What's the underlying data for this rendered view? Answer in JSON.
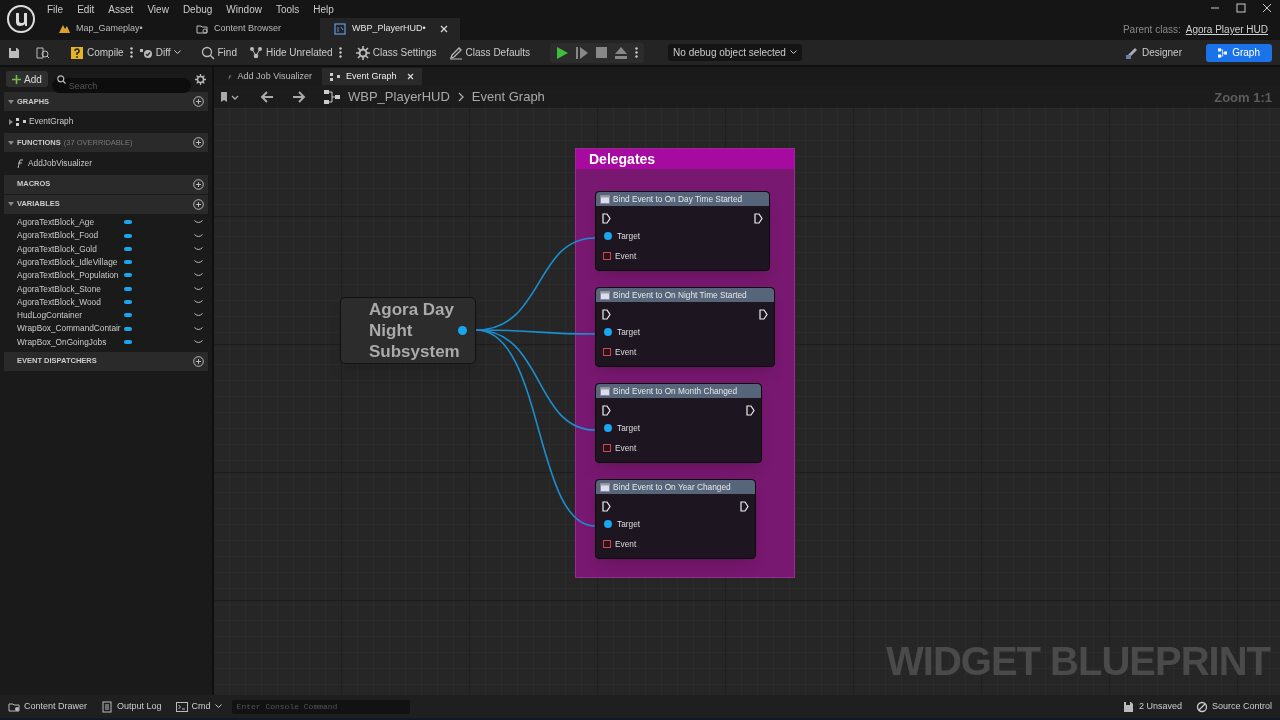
{
  "menu": [
    "File",
    "Edit",
    "Asset",
    "View",
    "Debug",
    "Window",
    "Tools",
    "Help"
  ],
  "document_tabs": [
    {
      "label": "Map_Gameplay•",
      "kind": "level",
      "selected": false,
      "closable": false
    },
    {
      "label": "Content Browser",
      "kind": "browser",
      "selected": false,
      "closable": false
    },
    {
      "label": "WBP_PlayerHUD•",
      "kind": "widget",
      "selected": true,
      "closable": true
    }
  ],
  "parent_class": {
    "label": "Parent class:",
    "value": "Agora Player HUD"
  },
  "toolbar": [
    {
      "label": "Compile",
      "kind": "compile",
      "menu": true
    },
    {
      "label": "Diff",
      "kind": "diff",
      "menu": false
    },
    {
      "label": "Find",
      "kind": "find",
      "menu": false
    },
    {
      "label": "Hide Unrelated",
      "kind": "hide",
      "menu": true
    },
    {
      "label": "Class Settings",
      "kind": "settings",
      "menu": false
    },
    {
      "label": "Class Defaults",
      "kind": "defaults",
      "menu": false
    }
  ],
  "debug_dropdown": "No debug object selected",
  "mode_buttons": [
    {
      "label": "Designer",
      "kind": "designer",
      "selected": false
    },
    {
      "label": "Graph",
      "kind": "graph",
      "selected": true
    }
  ],
  "my_blueprint": {
    "add_button": "Add",
    "search_placeholder": "Search",
    "sections": [
      {
        "title": "GRAPHS",
        "expanded": true,
        "items": [
          {
            "label": "EventGraph",
            "kind": "graph"
          }
        ]
      },
      {
        "title": "FUNCTIONS",
        "note": "(37 OVERRIDABLE)",
        "expanded": true,
        "items": [
          {
            "label": "AddJobVisualizer",
            "kind": "function"
          }
        ]
      },
      {
        "title": "MACROS",
        "expanded": false
      },
      {
        "title": "VARIABLES",
        "expanded": true,
        "items": [
          {
            "label": "AgoraTextBlock_Age",
            "kind": "variable"
          },
          {
            "label": "AgoraTextBlock_Food",
            "kind": "variable"
          },
          {
            "label": "AgoraTextBlock_Gold",
            "kind": "variable"
          },
          {
            "label": "AgoraTextBlock_IdleVillage",
            "kind": "variable"
          },
          {
            "label": "AgoraTextBlock_Population",
            "kind": "variable"
          },
          {
            "label": "AgoraTextBlock_Stone",
            "kind": "variable"
          },
          {
            "label": "AgoraTextBlock_Wood",
            "kind": "variable"
          },
          {
            "label": "HudLogContainer",
            "kind": "variable"
          },
          {
            "label": "WrapBox_CommandContair",
            "kind": "variable"
          },
          {
            "label": "WrapBox_OnGoingJobs",
            "kind": "variable"
          }
        ]
      },
      {
        "title": "EVENT DISPATCHERS",
        "expanded": false
      }
    ]
  },
  "graph_tabs": [
    {
      "label": "Add Job Visualizer",
      "kind": "function",
      "selected": false
    },
    {
      "label": "Event Graph",
      "kind": "graph",
      "selected": true
    }
  ],
  "breadcrumb": [
    "WBP_PlayerHUD",
    "Event Graph"
  ],
  "zoom_label": "Zoom 1:1",
  "graph": {
    "comment": "Delegates",
    "variable_node": "Agora Day Night Subsystem",
    "bind_nodes": [
      {
        "title": "Bind Event to On Day Time Started",
        "target": "Target",
        "event": "Event"
      },
      {
        "title": "Bind Event to On Night Time Started",
        "target": "Target",
        "event": "Event"
      },
      {
        "title": "Bind Event to On Month Changed",
        "target": "Target",
        "event": "Event"
      },
      {
        "title": "Bind Event to On Year Changed",
        "target": "Target",
        "event": "Event"
      }
    ],
    "watermark": "WIDGET BLUEPRINT"
  },
  "status_bar": {
    "left": [
      {
        "label": "Content Drawer",
        "kind": "drawer"
      },
      {
        "label": "Output Log",
        "kind": "log"
      }
    ],
    "cmd": "Cmd",
    "console_placeholder": "Enter Console Command",
    "right": [
      {
        "label": "2 Unsaved",
        "kind": "unsaved"
      },
      {
        "label": "Source Control",
        "kind": "source"
      }
    ]
  }
}
